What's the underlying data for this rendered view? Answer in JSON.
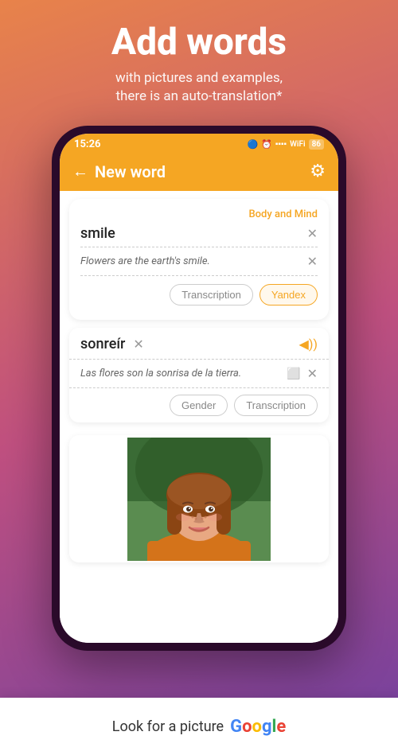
{
  "header": {
    "title": "Add words",
    "subtitle_line1": "with pictures and examples,",
    "subtitle_line2": "there is an auto-translation*"
  },
  "status_bar": {
    "time": "15:26",
    "icons": "🔵 ⏰ 📶 VO WiFi 🔋"
  },
  "app_header": {
    "title": "New word",
    "back_label": "←",
    "settings_label": "⚙"
  },
  "card": {
    "category": "Body and Mind",
    "word": "smile",
    "example": "Flowers are the earth's smile.",
    "transcription_btn": "Transcription",
    "yandex_btn": "Yandex"
  },
  "translation": {
    "word": "sonreír",
    "example": "Las flores son la sonrisa de la tierra.",
    "gender_btn": "Gender",
    "transcription_btn": "Transcription"
  },
  "google_bar": {
    "text": "Look for a picture",
    "logo": "Google"
  }
}
